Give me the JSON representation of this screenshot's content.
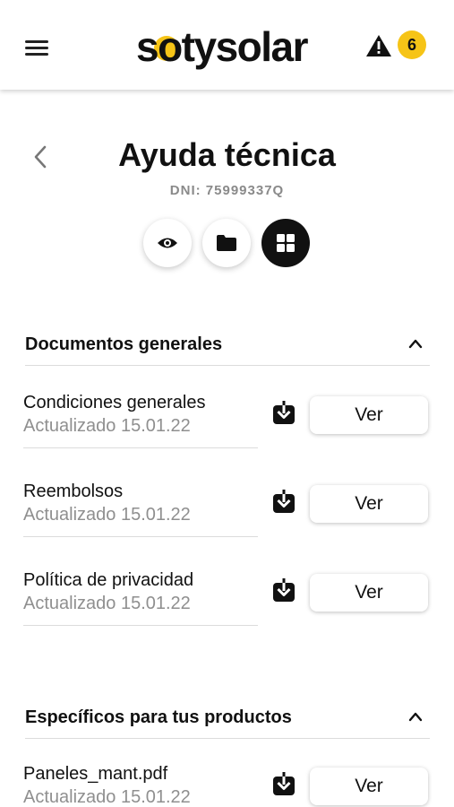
{
  "header": {
    "logo_text": "sotysolar",
    "alerts_count": "6"
  },
  "page": {
    "title": "Ayuda técnica",
    "dni": "DNI: 75999337Q"
  },
  "sections": [
    {
      "title": "Documentos generales",
      "documents": [
        {
          "name": "Condiciones generales",
          "updated": "Actualizado 15.01.22",
          "button": "Ver"
        },
        {
          "name": "Reembolsos",
          "updated": "Actualizado 15.01.22",
          "button": "Ver"
        },
        {
          "name": "Política de privacidad",
          "updated": "Actualizado 15.01.22",
          "button": "Ver"
        }
      ]
    },
    {
      "title": "Específicos para tus productos",
      "documents": [
        {
          "name": "Paneles_mant.pdf",
          "updated": "Actualizado 15.01.22",
          "button": "Ver"
        }
      ]
    }
  ],
  "colors": {
    "accent": "#f6c417",
    "text": "#111111",
    "muted": "#8f8f8f"
  }
}
